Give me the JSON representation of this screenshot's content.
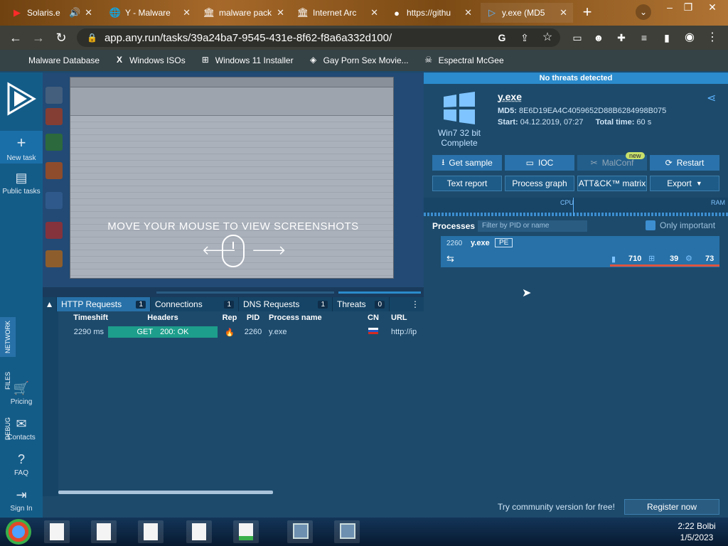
{
  "browser": {
    "tabs": [
      {
        "icon": "youtube-icon",
        "label": "Solaris.e",
        "color": "#ff0000",
        "has_audio": true
      },
      {
        "icon": "globe-icon",
        "label": "Y - Malware",
        "color": "#ffffff"
      },
      {
        "icon": "archive-icon",
        "label": "malware pack",
        "color": "#ffffff"
      },
      {
        "icon": "archive-icon",
        "label": "Internet Arc",
        "color": "#ffffff"
      },
      {
        "icon": "github-icon",
        "label": "https://githu",
        "color": "#ffffff"
      },
      {
        "icon": "anyrun-icon",
        "label": "y.exe (MD5",
        "color": "#5cb3ff"
      }
    ],
    "url": "app.any.run/tasks/39a24ba7-9545-431e-8f62-f8a6a332d100/",
    "bookmarks": [
      {
        "icon": "folder-icon",
        "label": "Malware Database"
      },
      {
        "icon": "x-icon",
        "label": "Windows ISOs"
      },
      {
        "icon": "windows-icon",
        "label": "Windows 11 Installer"
      },
      {
        "icon": "site-icon",
        "label": "Gay Porn Sex Movie..."
      },
      {
        "icon": "skull-icon",
        "label": "Espectral McGee"
      }
    ]
  },
  "sidebar": {
    "items": [
      {
        "icon": "plus-icon",
        "label": "New task"
      },
      {
        "icon": "file-icon",
        "label": "Public tasks"
      },
      {
        "icon": "cart-icon",
        "label": "Pricing"
      },
      {
        "icon": "mail-icon",
        "label": "Contacts"
      },
      {
        "icon": "help-icon",
        "label": "FAQ"
      },
      {
        "icon": "signin-icon",
        "label": "Sign In"
      }
    ]
  },
  "screenshot": {
    "hint": "MOVE YOUR MOUSE TO VIEW SCREENSHOTS"
  },
  "lower": {
    "tabs": [
      {
        "label": "HTTP Requests",
        "count": "1"
      },
      {
        "label": "Connections",
        "count": "1"
      },
      {
        "label": "DNS Requests",
        "count": "1"
      },
      {
        "label": "Threats",
        "count": "0"
      }
    ],
    "vertical_tabs": [
      "NETWORK",
      "FILES",
      "DEBUG"
    ],
    "columns": [
      "Timeshift",
      "Headers",
      "Rep",
      "PID",
      "Process name",
      "CN",
      "URL"
    ],
    "rows": [
      {
        "timeshift": "2290 ms",
        "method": "GET",
        "status": "200: OK",
        "pid": "2260",
        "process": "y.exe",
        "url": "http://ip."
      }
    ]
  },
  "task": {
    "banner": "No threats detected",
    "os": "Win7 32 bit",
    "status": "Complete",
    "filename": "y.exe",
    "md5_label": "MD5:",
    "md5": "8E6D19EA4C4059652D88B6284998B075",
    "start_label": "Start:",
    "start": "04.12.2019, 07:27",
    "total_label": "Total time:",
    "total": "60 s",
    "buttons": {
      "get_sample": "Get sample",
      "ioc": "IOC",
      "malconf": "MalConf",
      "new_badge": "new",
      "restart": "Restart",
      "text_report": "Text report",
      "process_graph": "Process graph",
      "attck": "ATT&CK™ matrix",
      "export": "Export"
    },
    "graph": {
      "cpu": "CPU",
      "ram": "RAM"
    },
    "processes_label": "Processes",
    "filter_placeholder": "Filter by PID or name",
    "only_important": "Only important",
    "process": {
      "pid": "2260",
      "name": "y.exe",
      "badge": "PE",
      "files": "710",
      "registry": "39",
      "modules": "73"
    },
    "community": "Try community version for free!",
    "register": "Register now"
  },
  "taskbar": {
    "time": "2:22 Bolbi",
    "date": "1/5/2023"
  },
  "colors": {
    "accent": "#2771a8",
    "panel": "#1d4a6b",
    "banner": "#2b8bcc",
    "ok": "#1d9e8c",
    "danger": "#e0543f"
  }
}
